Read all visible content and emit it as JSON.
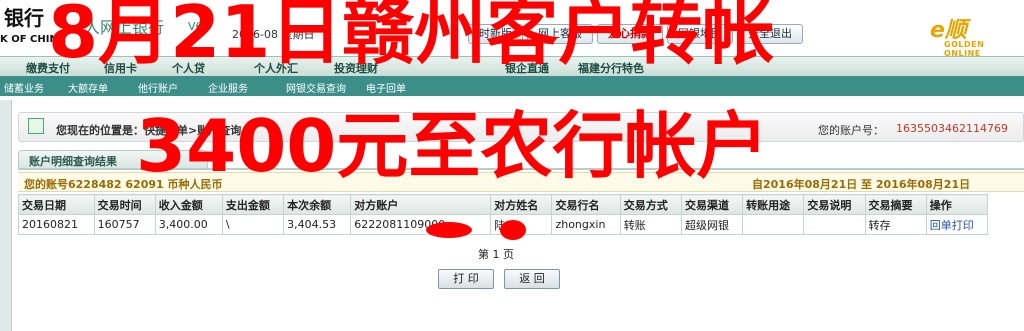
{
  "header": {
    "bank_name": "银行",
    "bank_sub": "K OF CHINA",
    "pbank_label": "人网上银行",
    "pbank_version": "V6",
    "date": "2016-08 星期日",
    "top_buttons": [
      "时新版",
      "网上客服",
      "爱心捐款",
      "网银地图",
      "安全退出"
    ],
    "logo_text": "GOLDEN ONLINE"
  },
  "nav1": [
    "缴费支付",
    "信用卡",
    "个人贷",
    "个人外汇",
    "投资理财",
    "银企直通",
    "福建分行特色"
  ],
  "nav2": [
    "储蓄业务",
    "大额存单",
    "他行账户",
    "企业服务",
    "网银交易查询",
    "电子回单"
  ],
  "location": {
    "label": "您现在的位置是：快捷菜单>账户查询",
    "account_label": "您的账户号：",
    "account_no": "1635503462114769"
  },
  "panel": {
    "title": "账户明细查询结果",
    "account_info": "您的账号6228482 62091 币种人民币",
    "date_range": "自2016年08月21日  至  2016年08月21日"
  },
  "table": {
    "headers": [
      "交易日期",
      "交易时间",
      "收入金额",
      "支出金额",
      "本次余额",
      "对方账户",
      "对方姓名",
      "交易行名",
      "交易方式",
      "交易渠道",
      "转账用途",
      "交易说明",
      "交易摘要",
      "操作"
    ],
    "rows": [
      [
        "20160821",
        "160757",
        "3,400.00",
        "\\",
        "3,404.53",
        "6222081109000",
        "陆",
        "zhongxin",
        "转账",
        "超级网银",
        "",
        "",
        "转存",
        "回单打印"
      ]
    ]
  },
  "pager": "第 1 页",
  "buttons": {
    "print": "打 印",
    "back": "返 回"
  },
  "overlay": {
    "line1": "8月21日赣州客户转帐",
    "line2": "3400元至农行帐户"
  },
  "colors": {
    "overlay_red": "#ff0000",
    "nav_teal": "#3c8f89",
    "account_red": "#c0392b"
  }
}
